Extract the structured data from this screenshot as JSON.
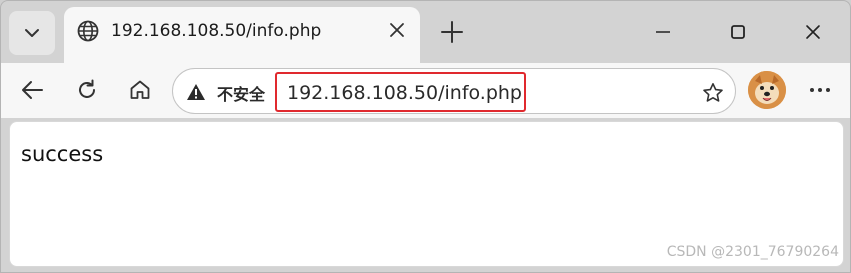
{
  "tab": {
    "title": "192.168.108.50/info.php",
    "favicon": "globe-icon"
  },
  "toolbar": {
    "security_label": "不安全",
    "url": "192.168.108.50/info.php"
  },
  "page": {
    "body_text": "success"
  },
  "watermark": "CSDN @2301_76790264",
  "colors": {
    "highlight": "#e0292e",
    "tab_bg": "#f7f7f7",
    "strip_bg": "#d3d3d3"
  }
}
